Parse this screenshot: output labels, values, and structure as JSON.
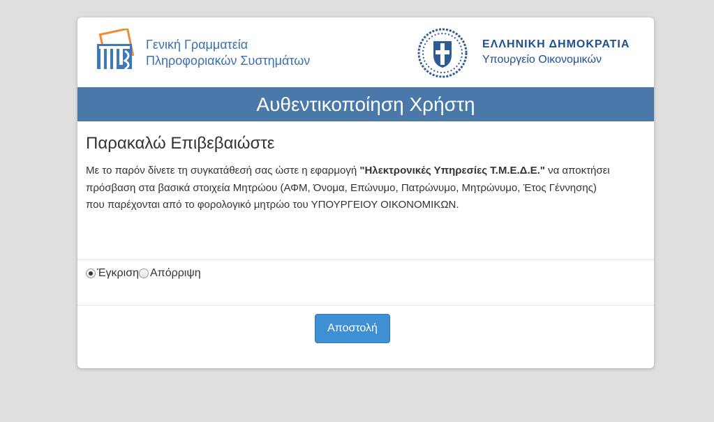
{
  "header": {
    "gsis_line1": "Γενική Γραμματεία",
    "gsis_line2": "Πληροφοριακών Συστημάτων",
    "hr_line1": "ΕΛΛΗΝΙΚΗ ΔΗΜΟΚΡΑΤΙΑ",
    "hr_line2": "Υπουργείο Οικονομικών"
  },
  "title_bar": {
    "text": "Αυθεντικοποίηση Χρήστη"
  },
  "content": {
    "heading": "Παρακαλώ Επιβεβαιώστε",
    "desc_part1": "Με το παρόν δίνετε τη συγκατάθεσή σας ώστε η εφαρμογή ",
    "desc_app_name": "\"Ηλεκτρονικές Υπηρεσίες Τ.Μ.Ε.Δ.Ε.\"",
    "desc_part2": " να αποκτήσει πρόσβαση στα βασικά στοιχεία Μητρώου (ΑΦΜ, Όνομα, Επώνυμο, Πατρώνυμο, Μητρώνυμο, Έτος Γέννησης)",
    "desc_part3": "που παρέχονται από το φορολογικό μητρώο του ΥΠΟΥΡΓΕΙΟΥ ΟΙΚΟΝΟΜΙΚΩΝ."
  },
  "form": {
    "approve_label": "Έγκριση",
    "reject_label": "Απόρριψη",
    "selected": "approve",
    "submit_label": "Αποστολή"
  },
  "colors": {
    "title_bar": "#4a78a8",
    "button": "#3f8fd4",
    "gsis_text": "#3a6fae",
    "hr_text": "#1f4f8f"
  },
  "icons": {
    "gsis_logo": "gsis-logo-icon",
    "coat_of_arms": "greek-coat-of-arms-icon"
  }
}
